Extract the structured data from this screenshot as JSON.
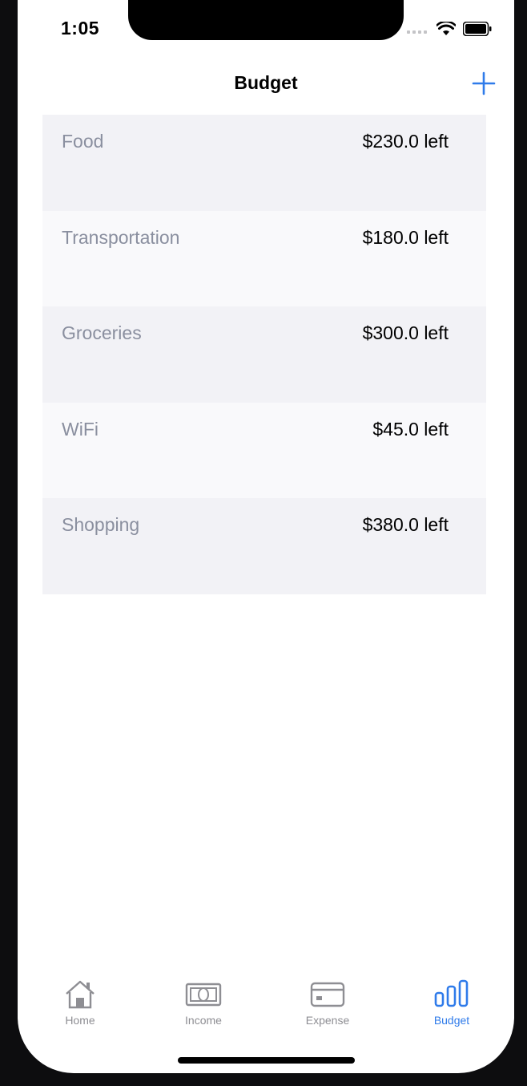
{
  "status_bar": {
    "time": "1:05"
  },
  "nav": {
    "title": "Budget",
    "add_icon": "plus-icon"
  },
  "budgets": [
    {
      "name": "Food",
      "amount": "$230.0 left"
    },
    {
      "name": "Transportation",
      "amount": "$180.0 left"
    },
    {
      "name": "Groceries",
      "amount": "$300.0 left"
    },
    {
      "name": "WiFi",
      "amount": "$45.0 left"
    },
    {
      "name": "Shopping",
      "amount": "$380.0 left"
    }
  ],
  "tab_bar": {
    "tabs": [
      {
        "label": "Home",
        "icon": "house-icon",
        "active": false
      },
      {
        "label": "Income",
        "icon": "banknote-icon",
        "active": false
      },
      {
        "label": "Expense",
        "icon": "credit-card-icon",
        "active": false
      },
      {
        "label": "Budget",
        "icon": "bar-chart-icon",
        "active": true
      }
    ]
  },
  "colors": {
    "accent": "#2f7bea",
    "inactive": "#8e8e93",
    "row_odd": "#f2f2f6",
    "row_even": "#f9f9fb",
    "category_text": "#8a8f9f"
  }
}
